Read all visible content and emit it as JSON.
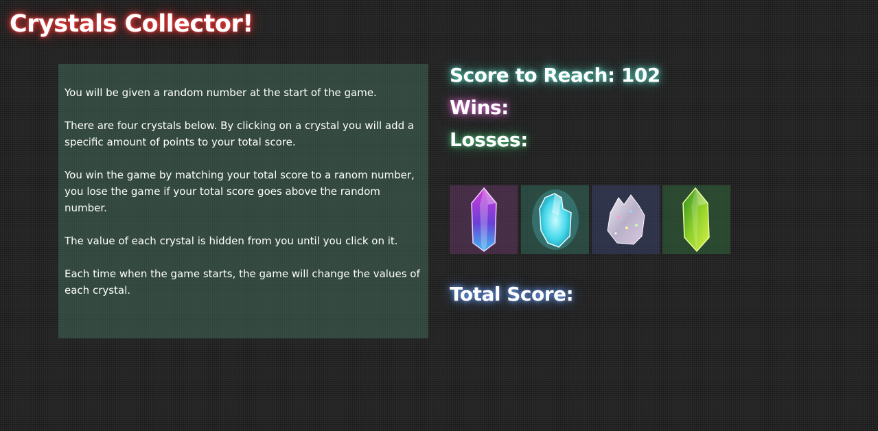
{
  "header": {
    "title": "Crystals Collector!"
  },
  "instructions": {
    "paragraphs": [
      "You will be given a random number at the start of the game.",
      "There are four crystals below. By clicking on a crystal you will add a specific amount of points to your total score.",
      "You win the game by matching your total score to a ranom number, you lose the game if your total score goes above the random number.",
      "The value of each crystal is hidden from you until you click on it.",
      "Each time when the game starts, the game will change the values of each crystal."
    ]
  },
  "stats": {
    "score_to_reach": "Score to Reach: 102",
    "wins": "Wins:",
    "losses": "Losses:",
    "total_score": "Total Score:"
  },
  "crystals": [
    {
      "name": "purple-crystal",
      "color": "#b13bd1"
    },
    {
      "name": "cyan-crystal",
      "color": "#4fe3f2"
    },
    {
      "name": "silver-crystal-cluster",
      "color": "#c9c4d6"
    },
    {
      "name": "green-crystal",
      "color": "#9ad62a"
    }
  ]
}
